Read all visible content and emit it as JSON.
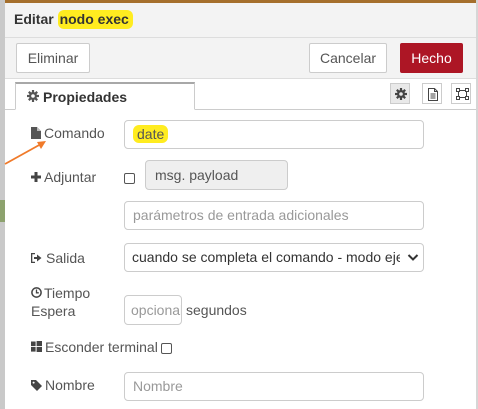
{
  "header": {
    "title_prefix": "Editar ",
    "title_node": "nodo exec"
  },
  "toolbar": {
    "delete_label": "Eliminar",
    "cancel_label": "Cancelar",
    "done_label": "Hecho"
  },
  "tabs": {
    "properties_label": "Propiedades",
    "buttons": [
      "settings-icon",
      "description-icon",
      "appearance-icon"
    ]
  },
  "form": {
    "command": {
      "label": "Comando",
      "value": "date"
    },
    "append": {
      "label": "Adjuntar",
      "checked": false,
      "typed_value": "msg. payload",
      "params_placeholder": "parámetros de entrada adicionales"
    },
    "output": {
      "label": "Salida",
      "selected": "cuando se completa el comando - modo ejecución"
    },
    "timeout": {
      "label_line1": "Tiempo",
      "label_line2": "Espera",
      "placeholder": "opcional",
      "unit": "segundos"
    },
    "hide_terminal": {
      "label": "Esconder terminal",
      "checked": false
    },
    "name": {
      "label": "Nombre",
      "placeholder": "Nombre"
    }
  },
  "colors": {
    "accent_done": "#ad1625",
    "highlight": "#ffec20",
    "annotation_arrow": "#f07a2a"
  }
}
